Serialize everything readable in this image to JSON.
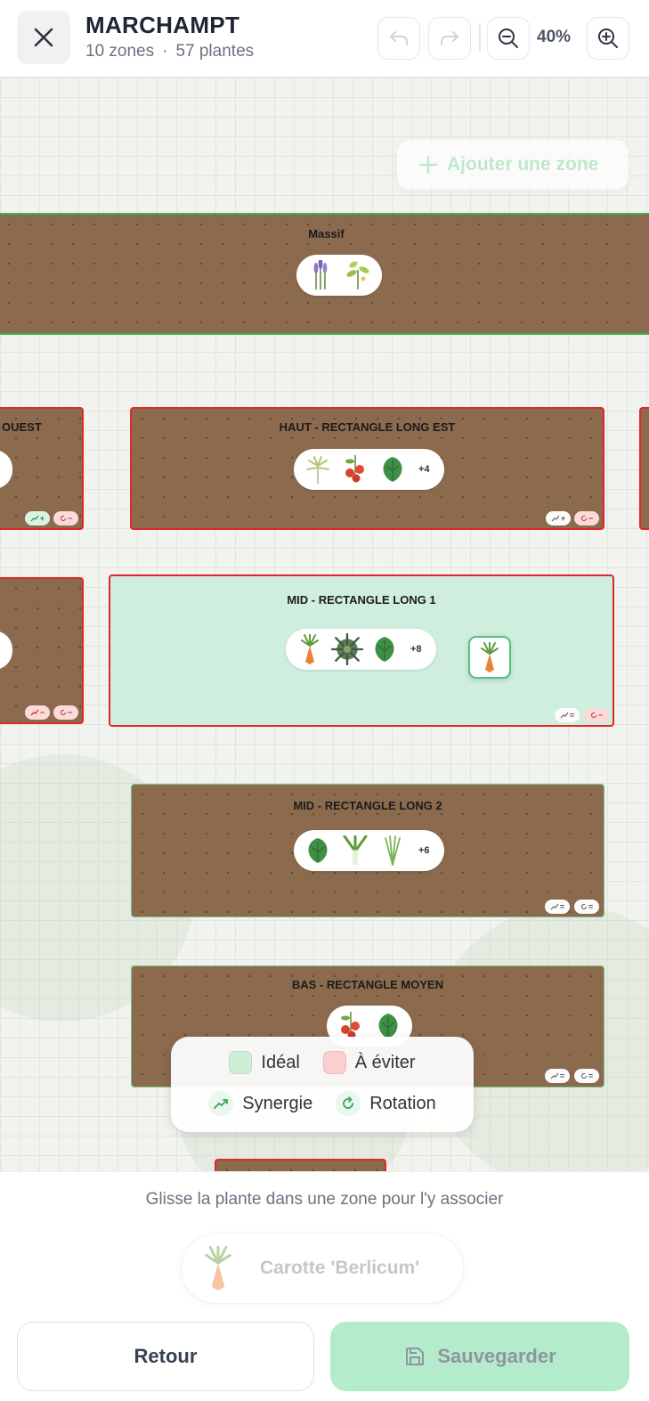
{
  "header": {
    "title": "MARCHAMPT",
    "zones_count": "10 zones",
    "separator": "·",
    "plants_count": "57 plantes",
    "zoom": "40%"
  },
  "canvas": {
    "add_zone_label": "Ajouter une zone",
    "zones": [
      {
        "id": "massif",
        "label": "Massif",
        "more": ""
      },
      {
        "id": "haut-ouest",
        "label": "OUEST",
        "more": ""
      },
      {
        "id": "haut-est",
        "label": "HAUT - RECTANGLE LONG EST",
        "more": "+4",
        "synergy": "+",
        "rotation": "−"
      },
      {
        "id": "mid-1",
        "label": "MID - RECTANGLE LONG 1",
        "more": "+8",
        "synergy": "=",
        "rotation": "−"
      },
      {
        "id": "mid-2",
        "label": "MID - RECTANGLE LONG 2",
        "more": "+6",
        "synergy": "=",
        "rotation": "="
      },
      {
        "id": "bas",
        "label": "BAS - RECTANGLE MOYEN",
        "more": "",
        "synergy": "=",
        "rotation": "="
      }
    ],
    "left_badges": {
      "haut_synergy": "+",
      "haut_rotation": "−",
      "mid_synergy": "−",
      "mid_rotation": "−"
    }
  },
  "legend": {
    "ideal": "Idéal",
    "avoid": "À éviter",
    "synergy": "Synergie",
    "rotation": "Rotation"
  },
  "bottom": {
    "hint": "Glisse la plante dans une zone pour l'y associer",
    "selected_plant": "Carotte 'Berlicum'",
    "back_label": "Retour",
    "save_label": "Sauvegarder"
  },
  "colors": {
    "accent": "#4fc27e",
    "ideal": "#cfecd7",
    "avoid": "#f9cfcf",
    "zone_soil": "#8c6a4e",
    "zone_border_bad": "#e0282a",
    "zone_border_good": "#3fae57"
  }
}
